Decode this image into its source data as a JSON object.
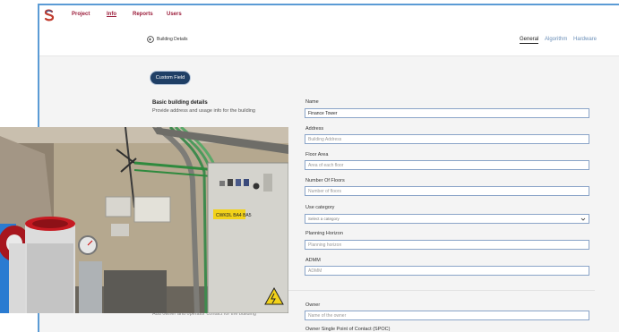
{
  "nav": {
    "items": [
      {
        "label": "Project"
      },
      {
        "label": "Info"
      },
      {
        "label": "Reports"
      },
      {
        "label": "Users"
      }
    ],
    "active": "Info"
  },
  "subheader": {
    "breadcrumb": "Building Details",
    "tabs": [
      {
        "label": "General"
      },
      {
        "label": "Algorithm"
      },
      {
        "label": "Hardware"
      }
    ],
    "active_tab": "General"
  },
  "custom_field_button": "Custom Field",
  "section": {
    "title": "Basic building details",
    "description": "Provide address and usage info for the building",
    "owner_description": "Add owner and operator contact for the building"
  },
  "fields": {
    "name": {
      "label": "Name",
      "value": "Finance Tower",
      "placeholder": ""
    },
    "address": {
      "label": "Address",
      "placeholder": "Building Address"
    },
    "floor_area": {
      "label": "Floor Area",
      "placeholder": "Area of each floor"
    },
    "floors": {
      "label": "Number Of Floors",
      "placeholder": "Number of floors"
    },
    "use_category": {
      "label": "Use category",
      "value": "Select a category"
    },
    "planning": {
      "label": "Planning Horizon",
      "placeholder": "Planning horizon"
    },
    "admm": {
      "label": "ADMM",
      "placeholder": "ADMM"
    },
    "owner": {
      "label": "Owner",
      "placeholder": "Name of the owner"
    },
    "spoc": {
      "label": "Owner Single Point of Contact (SPOC)"
    }
  },
  "photo": {
    "panel_label": "CWKDL BA4 BA5"
  },
  "colors": {
    "brand": "#9b1c3a",
    "pill": "#1f3f66",
    "input_border": "#8aa4c8",
    "frame_border": "#5b9bd5"
  }
}
